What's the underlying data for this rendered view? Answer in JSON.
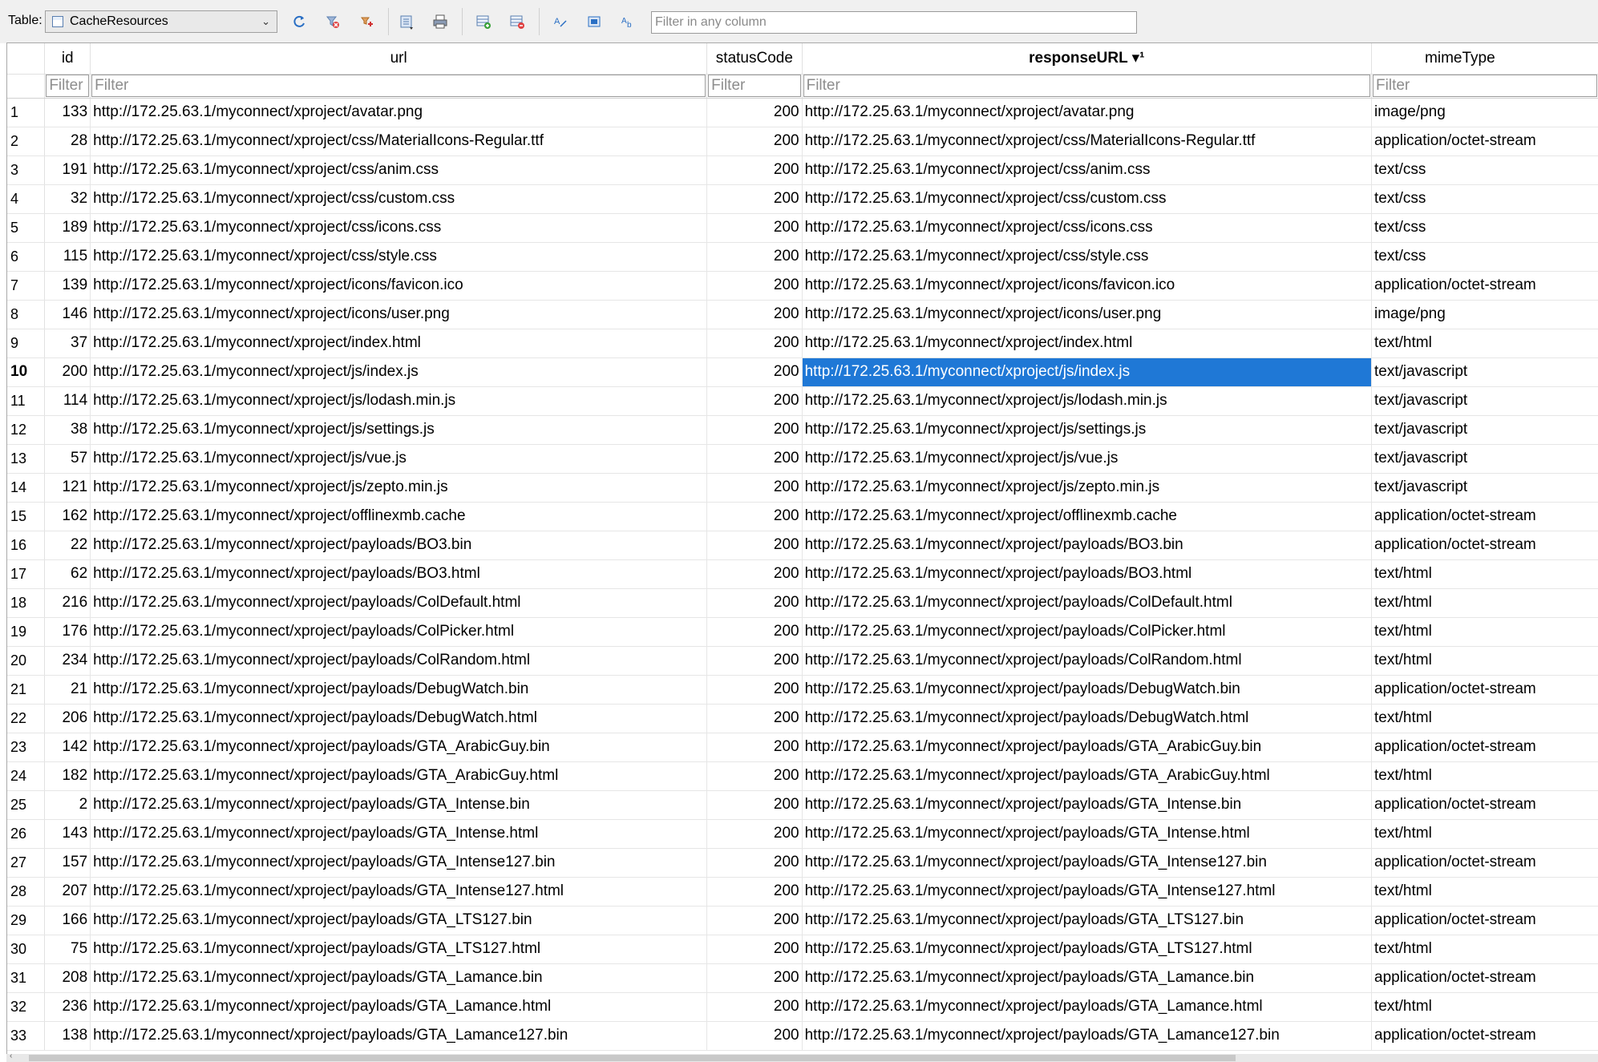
{
  "toolbar": {
    "table_label": "Table:",
    "table_value": "CacheResources",
    "filter_any_placeholder": "Filter in any column",
    "buttons": [
      "refresh-icon",
      "clear-filters-icon",
      "save-filter-icon",
      "print-icon",
      "insert-record-icon",
      "delete-record-icon",
      "find-icon",
      "find-replace-icon",
      "goto-icon"
    ]
  },
  "columns": {
    "id": "id",
    "url": "url",
    "statusCode": "statusCode",
    "responseURL": "responseURL ▾¹",
    "mimeType": "mimeType"
  },
  "filter_placeholder": "Filter",
  "selected_row": 10,
  "selected_column": "responseURL",
  "colors": {
    "selection": "#1f78d6",
    "toolbar_bg": "#f0f0f0"
  },
  "rows": [
    {
      "n": "1",
      "id": "133",
      "url": "http://172.25.63.1/myconnect/xproject/avatar.png",
      "status": "200",
      "resp": "http://172.25.63.1/myconnect/xproject/avatar.png",
      "mime": "image/png"
    },
    {
      "n": "2",
      "id": "28",
      "url": "http://172.25.63.1/myconnect/xproject/css/MaterialIcons-Regular.ttf",
      "status": "200",
      "resp": "http://172.25.63.1/myconnect/xproject/css/MaterialIcons-Regular.ttf",
      "mime": "application/octet-stream"
    },
    {
      "n": "3",
      "id": "191",
      "url": "http://172.25.63.1/myconnect/xproject/css/anim.css",
      "status": "200",
      "resp": "http://172.25.63.1/myconnect/xproject/css/anim.css",
      "mime": "text/css"
    },
    {
      "n": "4",
      "id": "32",
      "url": "http://172.25.63.1/myconnect/xproject/css/custom.css",
      "status": "200",
      "resp": "http://172.25.63.1/myconnect/xproject/css/custom.css",
      "mime": "text/css"
    },
    {
      "n": "5",
      "id": "189",
      "url": "http://172.25.63.1/myconnect/xproject/css/icons.css",
      "status": "200",
      "resp": "http://172.25.63.1/myconnect/xproject/css/icons.css",
      "mime": "text/css"
    },
    {
      "n": "6",
      "id": "115",
      "url": "http://172.25.63.1/myconnect/xproject/css/style.css",
      "status": "200",
      "resp": "http://172.25.63.1/myconnect/xproject/css/style.css",
      "mime": "text/css"
    },
    {
      "n": "7",
      "id": "139",
      "url": "http://172.25.63.1/myconnect/xproject/icons/favicon.ico",
      "status": "200",
      "resp": "http://172.25.63.1/myconnect/xproject/icons/favicon.ico",
      "mime": "application/octet-stream"
    },
    {
      "n": "8",
      "id": "146",
      "url": "http://172.25.63.1/myconnect/xproject/icons/user.png",
      "status": "200",
      "resp": "http://172.25.63.1/myconnect/xproject/icons/user.png",
      "mime": "image/png"
    },
    {
      "n": "9",
      "id": "37",
      "url": "http://172.25.63.1/myconnect/xproject/index.html",
      "status": "200",
      "resp": "http://172.25.63.1/myconnect/xproject/index.html",
      "mime": "text/html"
    },
    {
      "n": "10",
      "id": "200",
      "url": "http://172.25.63.1/myconnect/xproject/js/index.js",
      "status": "200",
      "resp": "http://172.25.63.1/myconnect/xproject/js/index.js",
      "mime": "text/javascript"
    },
    {
      "n": "11",
      "id": "114",
      "url": "http://172.25.63.1/myconnect/xproject/js/lodash.min.js",
      "status": "200",
      "resp": "http://172.25.63.1/myconnect/xproject/js/lodash.min.js",
      "mime": "text/javascript"
    },
    {
      "n": "12",
      "id": "38",
      "url": "http://172.25.63.1/myconnect/xproject/js/settings.js",
      "status": "200",
      "resp": "http://172.25.63.1/myconnect/xproject/js/settings.js",
      "mime": "text/javascript"
    },
    {
      "n": "13",
      "id": "57",
      "url": "http://172.25.63.1/myconnect/xproject/js/vue.js",
      "status": "200",
      "resp": "http://172.25.63.1/myconnect/xproject/js/vue.js",
      "mime": "text/javascript"
    },
    {
      "n": "14",
      "id": "121",
      "url": "http://172.25.63.1/myconnect/xproject/js/zepto.min.js",
      "status": "200",
      "resp": "http://172.25.63.1/myconnect/xproject/js/zepto.min.js",
      "mime": "text/javascript"
    },
    {
      "n": "15",
      "id": "162",
      "url": "http://172.25.63.1/myconnect/xproject/offlinexmb.cache",
      "status": "200",
      "resp": "http://172.25.63.1/myconnect/xproject/offlinexmb.cache",
      "mime": "application/octet-stream"
    },
    {
      "n": "16",
      "id": "22",
      "url": "http://172.25.63.1/myconnect/xproject/payloads/BO3.bin",
      "status": "200",
      "resp": "http://172.25.63.1/myconnect/xproject/payloads/BO3.bin",
      "mime": "application/octet-stream"
    },
    {
      "n": "17",
      "id": "62",
      "url": "http://172.25.63.1/myconnect/xproject/payloads/BO3.html",
      "status": "200",
      "resp": "http://172.25.63.1/myconnect/xproject/payloads/BO3.html",
      "mime": "text/html"
    },
    {
      "n": "18",
      "id": "216",
      "url": "http://172.25.63.1/myconnect/xproject/payloads/ColDefault.html",
      "status": "200",
      "resp": "http://172.25.63.1/myconnect/xproject/payloads/ColDefault.html",
      "mime": "text/html"
    },
    {
      "n": "19",
      "id": "176",
      "url": "http://172.25.63.1/myconnect/xproject/payloads/ColPicker.html",
      "status": "200",
      "resp": "http://172.25.63.1/myconnect/xproject/payloads/ColPicker.html",
      "mime": "text/html"
    },
    {
      "n": "20",
      "id": "234",
      "url": "http://172.25.63.1/myconnect/xproject/payloads/ColRandom.html",
      "status": "200",
      "resp": "http://172.25.63.1/myconnect/xproject/payloads/ColRandom.html",
      "mime": "text/html"
    },
    {
      "n": "21",
      "id": "21",
      "url": "http://172.25.63.1/myconnect/xproject/payloads/DebugWatch.bin",
      "status": "200",
      "resp": "http://172.25.63.1/myconnect/xproject/payloads/DebugWatch.bin",
      "mime": "application/octet-stream"
    },
    {
      "n": "22",
      "id": "206",
      "url": "http://172.25.63.1/myconnect/xproject/payloads/DebugWatch.html",
      "status": "200",
      "resp": "http://172.25.63.1/myconnect/xproject/payloads/DebugWatch.html",
      "mime": "text/html"
    },
    {
      "n": "23",
      "id": "142",
      "url": "http://172.25.63.1/myconnect/xproject/payloads/GTA_ArabicGuy.bin",
      "status": "200",
      "resp": "http://172.25.63.1/myconnect/xproject/payloads/GTA_ArabicGuy.bin",
      "mime": "application/octet-stream"
    },
    {
      "n": "24",
      "id": "182",
      "url": "http://172.25.63.1/myconnect/xproject/payloads/GTA_ArabicGuy.html",
      "status": "200",
      "resp": "http://172.25.63.1/myconnect/xproject/payloads/GTA_ArabicGuy.html",
      "mime": "text/html"
    },
    {
      "n": "25",
      "id": "2",
      "url": "http://172.25.63.1/myconnect/xproject/payloads/GTA_Intense.bin",
      "status": "200",
      "resp": "http://172.25.63.1/myconnect/xproject/payloads/GTA_Intense.bin",
      "mime": "application/octet-stream"
    },
    {
      "n": "26",
      "id": "143",
      "url": "http://172.25.63.1/myconnect/xproject/payloads/GTA_Intense.html",
      "status": "200",
      "resp": "http://172.25.63.1/myconnect/xproject/payloads/GTA_Intense.html",
      "mime": "text/html"
    },
    {
      "n": "27",
      "id": "157",
      "url": "http://172.25.63.1/myconnect/xproject/payloads/GTA_Intense127.bin",
      "status": "200",
      "resp": "http://172.25.63.1/myconnect/xproject/payloads/GTA_Intense127.bin",
      "mime": "application/octet-stream"
    },
    {
      "n": "28",
      "id": "207",
      "url": "http://172.25.63.1/myconnect/xproject/payloads/GTA_Intense127.html",
      "status": "200",
      "resp": "http://172.25.63.1/myconnect/xproject/payloads/GTA_Intense127.html",
      "mime": "text/html"
    },
    {
      "n": "29",
      "id": "166",
      "url": "http://172.25.63.1/myconnect/xproject/payloads/GTA_LTS127.bin",
      "status": "200",
      "resp": "http://172.25.63.1/myconnect/xproject/payloads/GTA_LTS127.bin",
      "mime": "application/octet-stream"
    },
    {
      "n": "30",
      "id": "75",
      "url": "http://172.25.63.1/myconnect/xproject/payloads/GTA_LTS127.html",
      "status": "200",
      "resp": "http://172.25.63.1/myconnect/xproject/payloads/GTA_LTS127.html",
      "mime": "text/html"
    },
    {
      "n": "31",
      "id": "208",
      "url": "http://172.25.63.1/myconnect/xproject/payloads/GTA_Lamance.bin",
      "status": "200",
      "resp": "http://172.25.63.1/myconnect/xproject/payloads/GTA_Lamance.bin",
      "mime": "application/octet-stream"
    },
    {
      "n": "32",
      "id": "236",
      "url": "http://172.25.63.1/myconnect/xproject/payloads/GTA_Lamance.html",
      "status": "200",
      "resp": "http://172.25.63.1/myconnect/xproject/payloads/GTA_Lamance.html",
      "mime": "text/html"
    },
    {
      "n": "33",
      "id": "138",
      "url": "http://172.25.63.1/myconnect/xproject/payloads/GTA_Lamance127.bin",
      "status": "200",
      "resp": "http://172.25.63.1/myconnect/xproject/payloads/GTA_Lamance127.bin",
      "mime": "application/octet-stream"
    }
  ]
}
